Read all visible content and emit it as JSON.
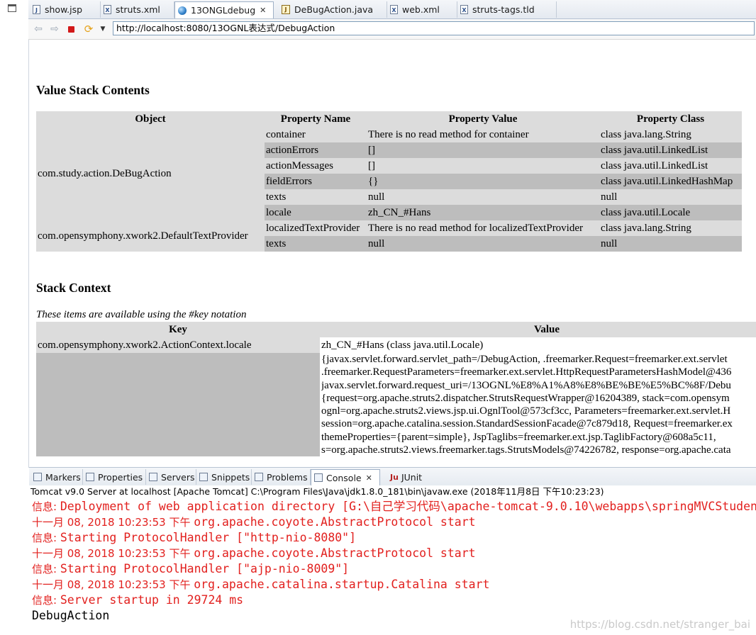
{
  "editor_tabs": [
    {
      "label": "show.jsp",
      "icon": "jsp-file-icon"
    },
    {
      "label": "struts.xml",
      "icon": "xml-file-icon"
    },
    {
      "label": "13ONGLdebug",
      "icon": "globe-icon",
      "close": "✕"
    },
    {
      "label": "DeBugAction.java",
      "icon": "java-file-icon"
    },
    {
      "label": "web.xml",
      "icon": "xml-file-icon"
    },
    {
      "label": "struts-tags.tld",
      "icon": "tld-file-icon"
    }
  ],
  "browser": {
    "url": "http://localhost:8080/13OGNL表达式/DebugAction"
  },
  "value_stack": {
    "heading": "Value Stack Contents",
    "columns": [
      "Object",
      "Property Name",
      "Property Value",
      "Property Class"
    ],
    "objects": [
      {
        "name": "com.study.action.DeBugAction",
        "rows": [
          [
            "container",
            "There is no read method for container",
            "class java.lang.String"
          ],
          [
            "actionErrors",
            "[]",
            "class java.util.LinkedList"
          ],
          [
            "actionMessages",
            "[]",
            "class java.util.LinkedList"
          ],
          [
            "fieldErrors",
            "{}",
            "class java.util.LinkedHashMap"
          ],
          [
            "texts",
            "null",
            "null"
          ],
          [
            "locale",
            "zh_CN_#Hans",
            "class java.util.Locale"
          ]
        ]
      },
      {
        "name": "com.opensymphony.xwork2.DefaultTextProvider",
        "rows": [
          [
            "localizedTextProvider",
            "There is no read method for localizedTextProvider",
            "class java.lang.String"
          ],
          [
            "texts",
            "null",
            "null"
          ]
        ]
      }
    ]
  },
  "stack_context": {
    "heading": "Stack Context",
    "note": "These items are available using the #key notation",
    "columns": [
      "Key",
      "Value"
    ],
    "rows": [
      {
        "key": "com.opensymphony.xwork2.ActionContext.locale",
        "value_lines": [
          "zh_CN_#Hans (class java.util.Locale)"
        ]
      },
      {
        "key": "",
        "value_lines": [
          "{javax.servlet.forward.servlet_path=/DebugAction, .freemarker.Request=freemarker.ext.servlet",
          ".freemarker.RequestParameters=freemarker.ext.servlet.HttpRequestParametersHashModel@436",
          "javax.servlet.forward.request_uri=/13OGNL%E8%A1%A8%E8%BE%BE%E5%BC%8F/Debu",
          "{request=org.apache.struts2.dispatcher.StrutsRequestWrapper@16204389, stack=com.opensym",
          "ognl=org.apache.struts2.views.jsp.ui.OgnlTool@573cf3cc, Parameters=freemarker.ext.servlet.H",
          "session=org.apache.catalina.session.StandardSessionFacade@7c879d18, Request=freemarker.ex",
          "themeProperties={parent=simple}, JspTaglibs=freemarker.ext.jsp.TaglibFactory@608a5c11,",
          "s=org.apache.struts2.views.freemarker.tags.StrutsModels@74226782, response=org.apache.cata"
        ]
      }
    ]
  },
  "view_tabs": [
    {
      "label": "Markers"
    },
    {
      "label": "Properties"
    },
    {
      "label": "Servers"
    },
    {
      "label": "Snippets"
    },
    {
      "label": "Problems"
    },
    {
      "label": "Console",
      "close": "✕"
    },
    {
      "label": "JUnit",
      "glyph": "Ju"
    }
  ],
  "console": {
    "header": "Tomcat v9.0 Server at localhost [Apache Tomcat] C:\\Program Files\\Java\\jdk1.8.0_181\\bin\\javaw.exe (2018年11月8日 下午10:23:23)",
    "lines": [
      {
        "prefix": "信息: ",
        "text": "Deployment of web application directory [G:\\自己学习代码\\apache-tomcat-9.0.10\\webapps\\springMVCStudent"
      },
      {
        "prefix": "十一月 08, 2018 10:23:53 下午 ",
        "text": "org.apache.coyote.AbstractProtocol start"
      },
      {
        "prefix": "信息: ",
        "text": "Starting ProtocolHandler [\"http-nio-8080\"]"
      },
      {
        "prefix": "十一月 08, 2018 10:23:53 下午 ",
        "text": "org.apache.coyote.AbstractProtocol start"
      },
      {
        "prefix": "信息: ",
        "text": "Starting ProtocolHandler [\"ajp-nio-8009\"]"
      },
      {
        "prefix": "十一月 08, 2018 10:23:53 下午 ",
        "text": "org.apache.catalina.startup.Catalina start"
      },
      {
        "prefix": "信息: ",
        "text": "Server startup in 29724 ms"
      }
    ],
    "output": "DebugAction",
    "watermark": "https://blog.csdn.net/stranger_bai"
  }
}
